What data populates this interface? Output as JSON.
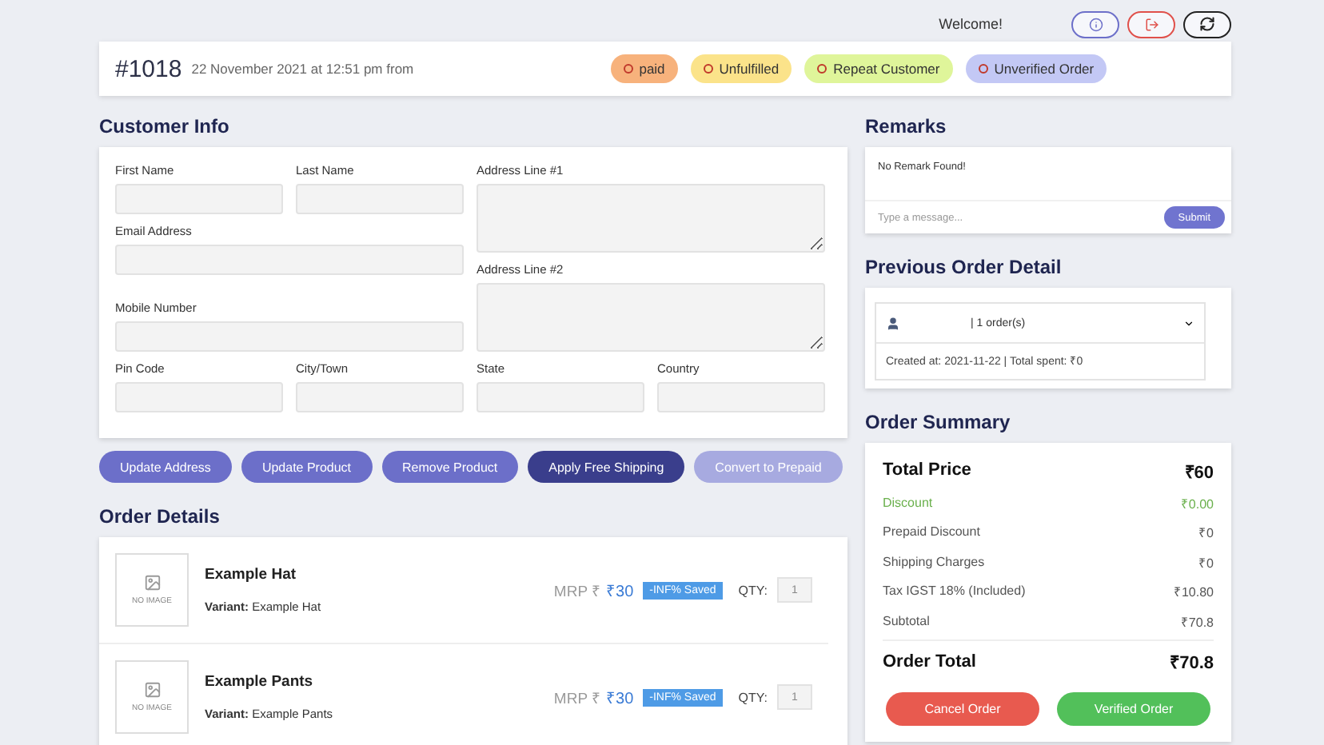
{
  "topbar": {
    "welcome": "Welcome!",
    "buttons": [
      {
        "kind": "info",
        "color": "#6c6fc9"
      },
      {
        "kind": "logout",
        "color": "#e0504a"
      },
      {
        "kind": "refresh",
        "color": "#222222"
      }
    ]
  },
  "order": {
    "number": "#1018",
    "date": "22 November 2021 at 12:51 pm from",
    "tags": [
      {
        "label": "paid",
        "color": "#f7b27c"
      },
      {
        "label": "Unfulfilled",
        "color": "#fbe38a"
      },
      {
        "label": "Repeat Customer",
        "color": "#dff59a"
      },
      {
        "label": "Unverified Order",
        "color": "#c3c8f5"
      }
    ]
  },
  "customer_info": {
    "title": "Customer Info",
    "fields": [
      {
        "label": "First Name",
        "kind": "line"
      },
      {
        "label": "Last Name",
        "kind": "line"
      },
      {
        "label": "Address Line #1",
        "kind": "area"
      },
      {
        "label": "Email Address",
        "kind": "line"
      },
      {
        "label": "Address Line #2",
        "kind": "area"
      },
      {
        "label": "Mobile Number",
        "kind": "line"
      },
      {
        "label": "Pin Code",
        "kind": "line"
      },
      {
        "label": "City/Town",
        "kind": "line"
      },
      {
        "label": "State",
        "kind": "line"
      },
      {
        "label": "Country",
        "kind": "line"
      }
    ]
  },
  "actions": [
    {
      "label": "Update Address",
      "kind": "normal"
    },
    {
      "label": "Update Product",
      "kind": "normal"
    },
    {
      "label": "Remove Product",
      "kind": "normal"
    },
    {
      "label": "Apply Free Shipping",
      "kind": "dark"
    },
    {
      "label": "Convert to Prepaid",
      "kind": "faded"
    }
  ],
  "order_details": {
    "title": "Order Details",
    "items": [
      {
        "image_text": "NO IMAGE",
        "name": "Example Hat",
        "variant": "**Variant:** Example Hat",
        "mrp": "MRP ₹",
        "price": "₹30",
        "saved": "-INF% Saved",
        "qty_label": "QTY:",
        "qty": "1"
      },
      {
        "image_text": "NO IMAGE",
        "name": "Example Pants",
        "variant": "**Variant:** Example Pants",
        "mrp": "MRP ₹",
        "price": "₹30",
        "saved": "-INF% Saved",
        "qty_label": "QTY:",
        "qty": "1"
      }
    ]
  },
  "remarks": {
    "title": "Remarks",
    "message": "No Remark Found!",
    "placeholder": "Type a message...",
    "submit": "Submit"
  },
  "previous_order": {
    "title": "Previous Order Detail",
    "orders": "| 1 order(s)",
    "detail": "Created at: 2021-11-22 | Total spent: ₹0"
  },
  "summary": {
    "title": "Order Summary",
    "rows": [
      {
        "label": "Total Price",
        "value": "₹60",
        "kind": "total"
      },
      {
        "label": "Discount",
        "value": "₹0.00",
        "kind": "discount"
      },
      {
        "label": "Prepaid Discount",
        "value": "₹0",
        "kind": "normal"
      },
      {
        "label": "Shipping Charges",
        "value": "₹0",
        "kind": "normal"
      },
      {
        "label": "Tax IGST 18% (Included)",
        "value": "₹10.80",
        "kind": "normal"
      },
      {
        "label": "Subtotal",
        "value": "₹70.8",
        "kind": "normal"
      },
      {
        "label": "Order Total",
        "value": "₹70.8",
        "kind": "total"
      }
    ],
    "buttons": [
      {
        "label": "Cancel Order",
        "kind": "cancel"
      },
      {
        "label": "Verified Order",
        "kind": "verify"
      }
    ]
  }
}
